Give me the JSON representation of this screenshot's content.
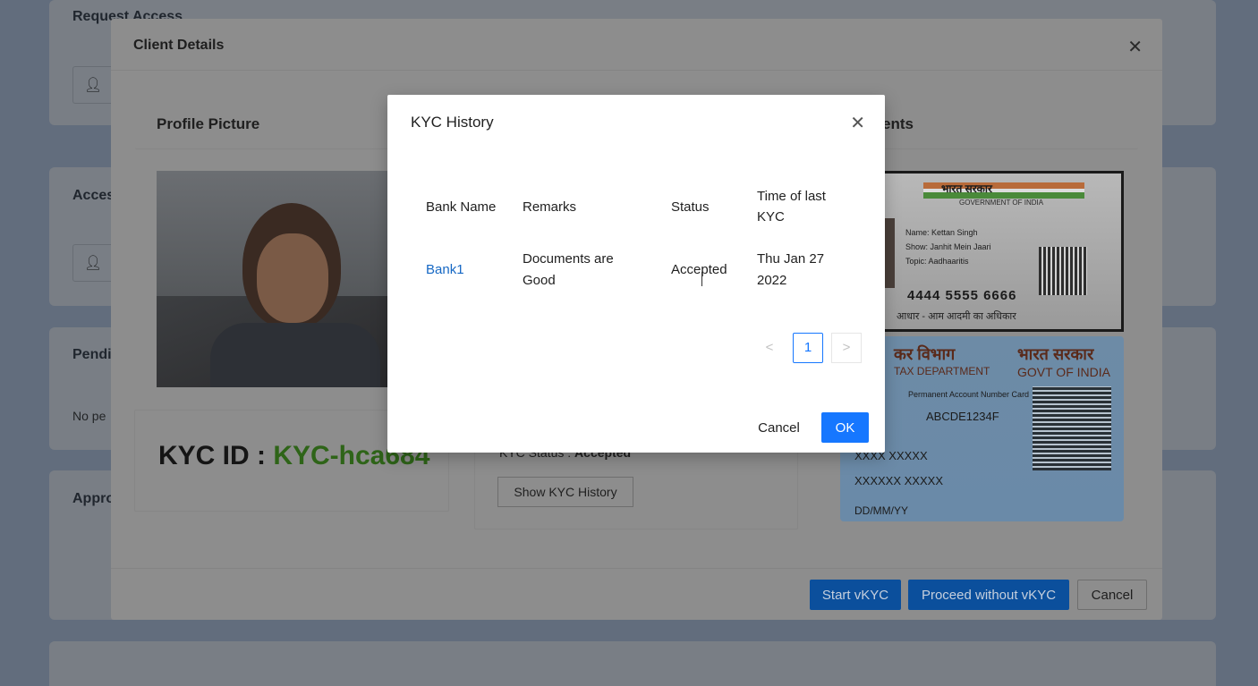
{
  "background": {
    "cards": [
      {
        "title": "Request Access",
        "has_input": true,
        "input_placeholder": "C"
      },
      {
        "title": "Acces",
        "has_input": true,
        "input_placeholder": "C"
      },
      {
        "title": "Pendi",
        "text": "No pe"
      },
      {
        "title": "Appro"
      }
    ]
  },
  "client_modal": {
    "title": "Client Details",
    "profile_picture_title": "Profile Picture",
    "documents_title": "ents",
    "kyc_id_label": "KYC ID : ",
    "kyc_id_value": "KYC-hca684",
    "kyc_status_label": "KYC Status : ",
    "kyc_status_value": "Accepted",
    "show_history_label": "Show KYC History",
    "aadhaar": {
      "header": "भारत सरकार",
      "gov": "GOVERNMENT OF INDIA",
      "name": "Name: Kettan Singh",
      "show": "Show: Janhit Mein Jaari",
      "topic": "Topic: Aadhaaritis",
      "number": "4444 5555 6666",
      "footer": "आधार - आम आदमी का अधिकार"
    },
    "pan": {
      "h1": "कर विभाग",
      "h2": "भारत सरकार",
      "h3": "TAX DEPARTMENT",
      "h4": "GOVT OF INDIA",
      "label": "Permanent Account Number Card",
      "pan_number": "ABCDE1234F",
      "name": "XXXX XXXXX",
      "father": "XXXXXX XXXXX",
      "dob": "DD/MM/YY"
    },
    "footer": {
      "start_vkyc": "Start vKYC",
      "proceed_without_vkyc": "Proceed without vKYC",
      "cancel": "Cancel"
    }
  },
  "kyc_modal": {
    "title": "KYC History",
    "columns": [
      "Bank Name",
      "Remarks",
      "Status",
      "Time of last KYC"
    ],
    "rows": [
      {
        "bank": "Bank1",
        "remarks": "Documents are Good",
        "status": "Accepted",
        "time": "Thu Jan 27 2022"
      }
    ],
    "pagination": {
      "prev": "<",
      "current": "1",
      "next": ">"
    },
    "cancel_label": "Cancel",
    "ok_label": "OK"
  }
}
